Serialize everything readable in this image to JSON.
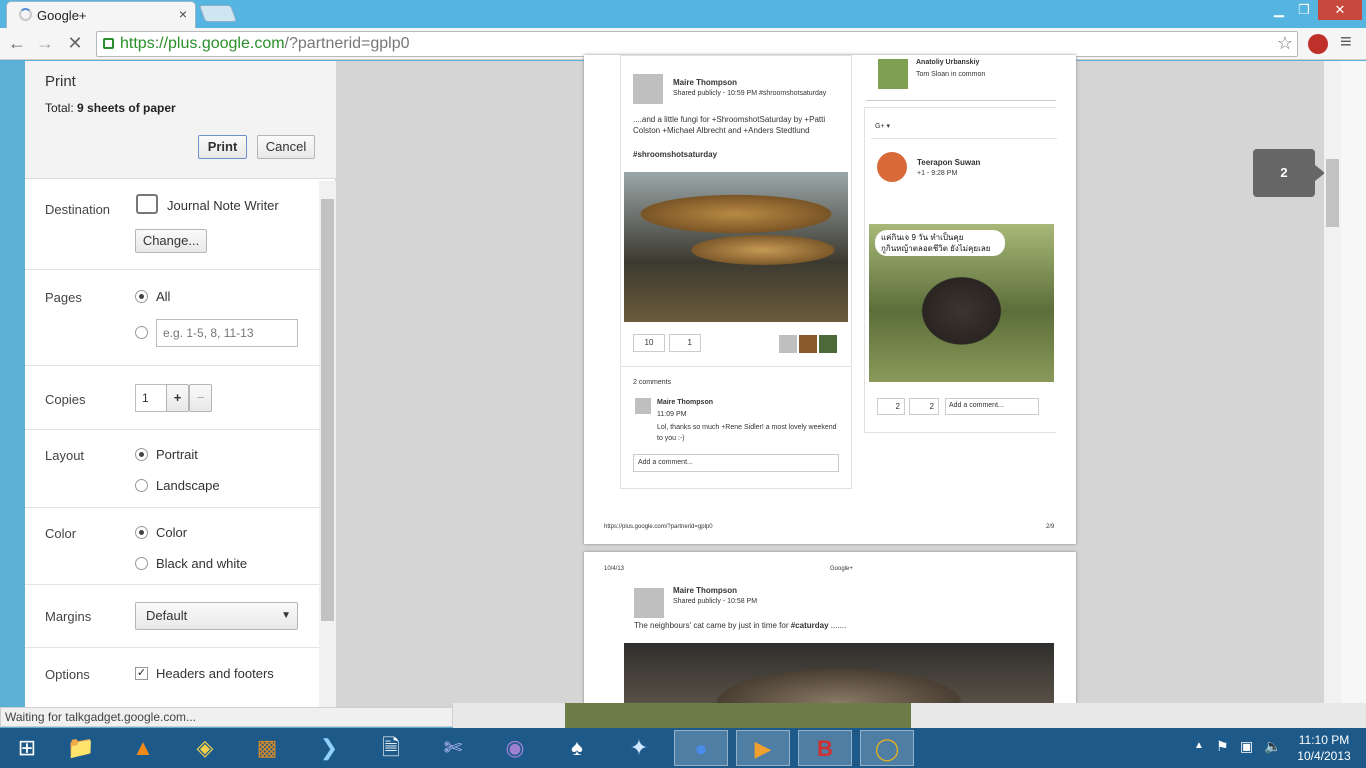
{
  "browser": {
    "tab_title": "Google+",
    "tab_close": "×",
    "url_host": "https://plus.google.com",
    "url_path": "/?partnerid=gplp0",
    "win_min": "▁",
    "win_max": "❐",
    "win_close": "✕",
    "menu_icon": "≡",
    "status_text": "Waiting for talkgadget.google.com..."
  },
  "print": {
    "title": "Print",
    "total_label": "Total: ",
    "total_value": "9 sheets of paper",
    "print_button": "Print",
    "cancel_button": "Cancel",
    "destination_label": "Destination",
    "destination_value": "Journal Note Writer",
    "change_button": "Change...",
    "pages_label": "Pages",
    "pages_all": "All",
    "pages_placeholder": "e.g. 1-5, 8, 11-13",
    "copies_label": "Copies",
    "copies_value": "1",
    "copies_plus": "+",
    "copies_minus": "−",
    "layout_label": "Layout",
    "layout_portrait": "Portrait",
    "layout_landscape": "Landscape",
    "color_label": "Color",
    "color_color": "Color",
    "color_bw": "Black and white",
    "margins_label": "Margins",
    "margins_value": "Default",
    "options_label": "Options",
    "options_headers": "Headers and footers"
  },
  "preview": {
    "page_badge": "2",
    "page1": {
      "post_author": "Maire Thompson",
      "post_meta": "Shared publicly  -  10:59 PM   #shroomshotsaturday",
      "post_text": "....and a little fungi for +ShroomshotSaturday by +Patti Colston +Michael Albrecht and +Anders Stedtlund",
      "post_hashtag": "#shroomshotsaturday",
      "plus_count": "10",
      "share_count": "1",
      "comments_count": "2 comments",
      "comment_author": "Maire Thompson",
      "comment_time": "11:09 PM",
      "comment_text": "Lol, thanks so much +Rene Sidler! a most lovely weekend to you :-)",
      "add_comment": "Add a comment...",
      "side_user": "Anatoliy Urbanskiy",
      "side_user_sub": "Tom Sloan in common",
      "side_gplus": "G+ ▾",
      "side_author": "Teerapon Suwan",
      "side_meta": "+1  -  9:28 PM",
      "side_thai_1": "แค่กินเจ 9 วัน ทำเป็นคุย",
      "side_thai_2": "กูกินหญ้าตลอดชีวิต ยังไม่คุยเลย",
      "side_plus": "2",
      "side_share": "2",
      "side_add_comment": "Add a comment...",
      "footer_url": "https://plus.google.com/?partnerid=gplp0",
      "footer_page": "2/9"
    },
    "page2": {
      "header_date": "10/4/13",
      "header_title": "Google+",
      "post_author": "Maire Thompson",
      "post_meta": "Shared publicly  -  10:58 PM",
      "post_text_a": "The neighbours' cat came by just in time for ",
      "post_text_b": "#caturday",
      "post_text_c": "  ......."
    }
  },
  "taskbar": {
    "time": "11:10 PM",
    "date": "10/4/2013"
  }
}
